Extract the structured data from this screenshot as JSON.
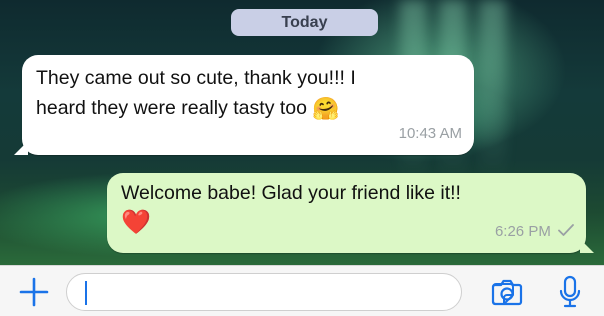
{
  "conversation": {
    "date_label": "Today",
    "messages": [
      {
        "direction": "incoming",
        "text_line1": "They came out so cute, thank you!!! I",
        "text_line2": "heard they were really tasty too",
        "emoji": "🤗",
        "time": "10:43 AM"
      },
      {
        "direction": "outgoing",
        "text_line1": "Welcome babe! Glad your friend like it!!",
        "emoji": "❤️",
        "time": "6:26 PM",
        "status_icon": "check-icon"
      }
    ]
  },
  "composer": {
    "value": "",
    "icons": [
      "plus-icon",
      "sticker-icon",
      "camera-icon",
      "microphone-icon"
    ],
    "accent_color": "#1a73e8"
  },
  "colors": {
    "incoming_bubble": "#ffffff",
    "outgoing_bubble": "#dcf8c6",
    "date_pill": "#c9cfe6"
  }
}
